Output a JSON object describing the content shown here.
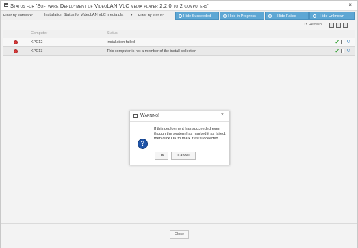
{
  "window": {
    "title": "Status for 'Software Deployment of VideoLAN VLC media player 2.2.0 to 2 computers'",
    "close_glyph": "×"
  },
  "filters": {
    "software_label": "Filter by software:",
    "software_value": "Installation Status for VideoLAN VLC media pla",
    "status_label": "Filter by status:",
    "buttons": [
      "Hide Succeeded",
      "Hide in Progress",
      "Hide Failed",
      "Hide Unknown"
    ]
  },
  "toolbar": {
    "refresh_label": "Refresh",
    "icons": [
      "refresh-icon",
      "export-icon",
      "print-icon",
      "report-icon"
    ]
  },
  "grid": {
    "columns": [
      "Computer",
      "Status"
    ],
    "rows": [
      {
        "computer": "KPC12",
        "status": "Installation failed",
        "state_icon": "error-icon"
      },
      {
        "computer": "KPC13",
        "status": "This computer is not a member of the install collection",
        "state_icon": "error-icon"
      }
    ]
  },
  "dialog": {
    "title": "Warning!",
    "message": "If this deployment has succeeded even though the system has marked it as failed, then click OK to mark it as succeeded.",
    "ok_label": "OK",
    "cancel_label": "Cancel",
    "icon": "question-icon",
    "close_glyph": "×"
  },
  "footer": {
    "close_label": "Close"
  },
  "colors": {
    "filter_button": "#5ea7d4",
    "error": "#d93b3b",
    "success_check": "#3aa33a",
    "question_icon": "#1f54a8"
  }
}
